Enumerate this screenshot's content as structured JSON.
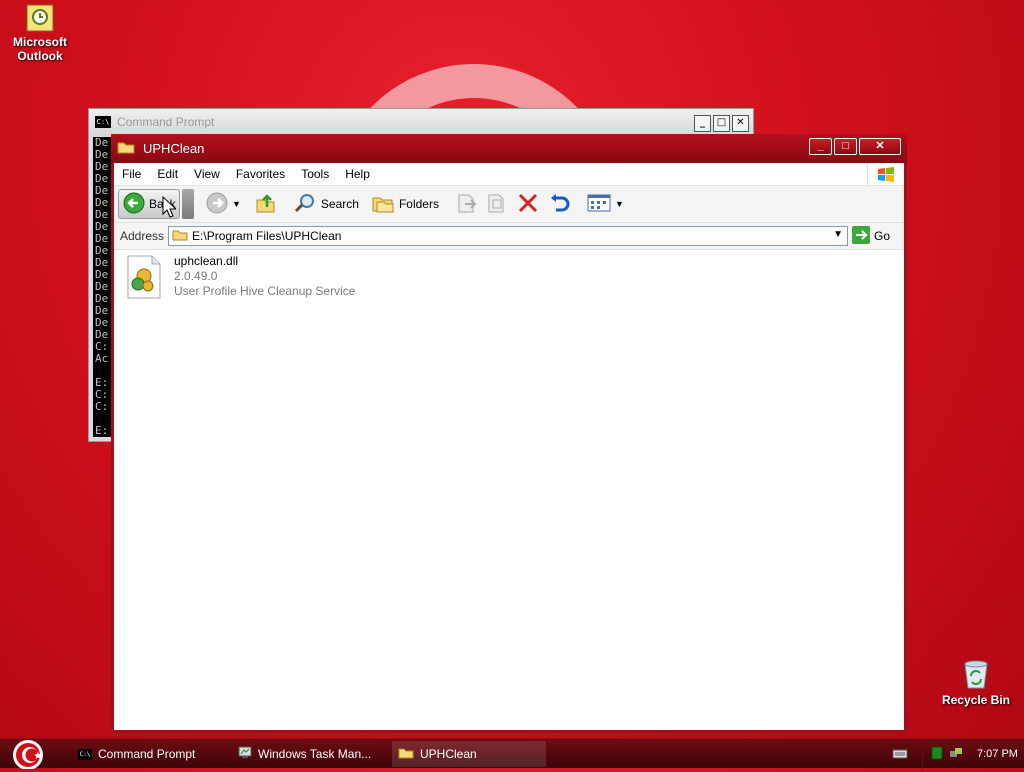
{
  "desktop": {
    "icons": [
      {
        "label": "Microsoft\nOutlook",
        "icon": "outlook-icon"
      },
      {
        "label": "Recycle Bin",
        "icon": "recycle-bin-icon"
      }
    ]
  },
  "cmd": {
    "title": "Command Prompt",
    "lines": [
      "De",
      "De",
      "De",
      "De",
      "De",
      "De",
      "De",
      "De",
      "De",
      "De",
      "De",
      "De",
      "De",
      "De",
      "De",
      "De",
      "De",
      "C:",
      "Ac",
      "",
      "E:",
      "C:",
      "C:",
      "",
      "E:"
    ]
  },
  "explorer": {
    "title": "UPHClean",
    "menu": [
      "File",
      "Edit",
      "View",
      "Favorites",
      "Tools",
      "Help"
    ],
    "toolbar": {
      "back": "Back",
      "search": "Search",
      "folders": "Folders"
    },
    "address_label": "Address",
    "address_value": "E:\\Program Files\\UPHClean",
    "go_label": "Go",
    "file": {
      "name": "uphclean.dll",
      "version": "2.0.49.0",
      "description": "User Profile Hive Cleanup Service"
    }
  },
  "taskbar": {
    "tasks": [
      "Command Prompt",
      "Windows Task Man...",
      "UPHClean"
    ],
    "clock": "7:07 PM"
  },
  "colors": {
    "accent": "#b0101c",
    "desktop": "#d0101c"
  }
}
